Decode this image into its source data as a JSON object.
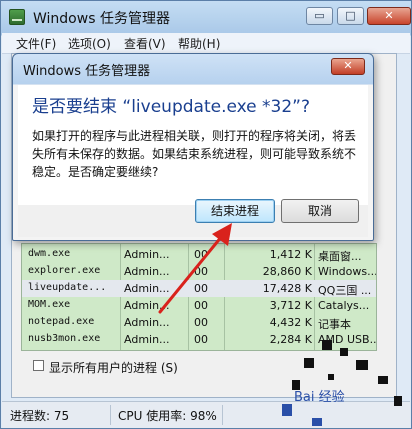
{
  "main_window": {
    "title": "Windows 任务管理器",
    "min_btn": "▭",
    "max_btn": "□",
    "close_btn": "✕",
    "menu": [
      "文件(F)",
      "选项(O)",
      "查看(V)",
      "帮助(H)"
    ]
  },
  "process_table": {
    "rows": [
      [
        "dwm.exe",
        "Admin...",
        "00",
        "1,412 K",
        "桌面窗..."
      ],
      [
        "explorer.exe",
        "Admin...",
        "00",
        "28,860 K",
        "Windows..."
      ],
      [
        "liveupdate...",
        "Admin...",
        "00",
        "17,428 K",
        "QQ三国 ..."
      ],
      [
        "MOM.exe",
        "Admin...",
        "00",
        "3,712 K",
        "Catalys..."
      ],
      [
        "notepad.exe",
        "Admin...",
        "00",
        "4,432 K",
        "记事本"
      ],
      [
        "nusb3mon.exe",
        "Admin...",
        "00",
        "2,284 K",
        "AMD USB..."
      ]
    ],
    "selected_row": 2
  },
  "show_all_users": {
    "label": "显示所有用户的进程 (S)",
    "checked": false
  },
  "status_bar": {
    "process_count": "进程数: 75",
    "cpu_usage": "CPU 使用率: 98%"
  },
  "dialog": {
    "title": "Windows 任务管理器",
    "close_btn": "✕",
    "heading": "是否要结束 “liveupdate.exe *32”?",
    "message": "如果打开的程序与此进程相关联，则打开的程序将关闭，将丢失所有未保存的数据。如果结束系统进程，则可能导致系统不稳定。是否确定要继续?",
    "end_button": "结束进程",
    "cancel_button": "取消"
  },
  "colors": {
    "annotation_arrow": "#d9221c",
    "list_background": "#cfe9c8",
    "heading_blue": "#1a3f8f"
  },
  "watermark": {
    "text": "Bai 经验"
  }
}
